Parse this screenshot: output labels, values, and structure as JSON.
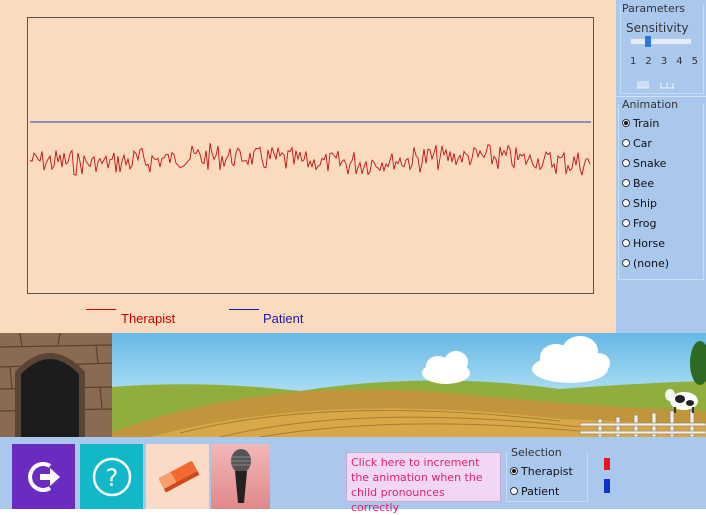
{
  "legend": {
    "therapist_label": "Therapist",
    "patient_label": "Patient",
    "therapist_color": "#cc0000",
    "patient_color": "#1a1aaa"
  },
  "parameters": {
    "title": "Parameters",
    "sensitivity_label": "Sensitivity",
    "sensitivity_ticks": [
      "1",
      "2",
      "3",
      "4",
      "5"
    ],
    "sensitivity_value": 2
  },
  "animation": {
    "title": "Animation",
    "options": [
      "Train",
      "Car",
      "Snake",
      "Bee",
      "Ship",
      "Frog",
      "Horse",
      "(none)"
    ],
    "selected": "Train"
  },
  "toolbar": {
    "exit_icon": "exit-arrow-icon",
    "help_icon": "question-mark-icon",
    "erase_icon": "eraser-icon",
    "mic_icon": "microphone-icon",
    "increment_text": "Click here to increment the animation when the child pronounces correctly"
  },
  "selection": {
    "title": "Selection",
    "options": [
      "Therapist",
      "Patient"
    ],
    "selected": "Therapist",
    "therapist_color": "#e01818",
    "patient_color": "#1030d0"
  },
  "colors": {
    "graph_bg": "#fadbbd",
    "panel_bg": "#aac8ee",
    "exit_btn": "#6a2cc0",
    "help_btn": "#12b8c8"
  }
}
